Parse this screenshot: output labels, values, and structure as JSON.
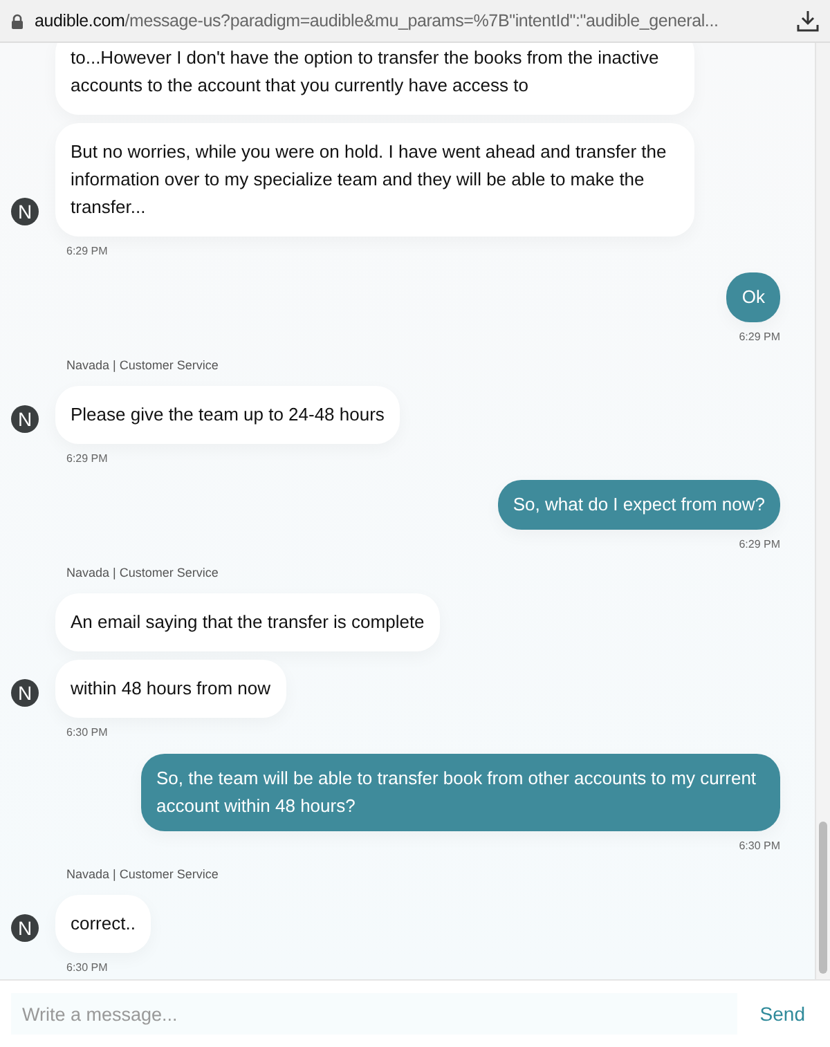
{
  "address_bar": {
    "url_host": "audible.com",
    "url_path": "/message-us?paradigm=audible&mu_params=%7B\"intentId\":\"audible_general..."
  },
  "conversation": [
    {
      "kind": "agent",
      "avatar": "N",
      "messages": [
        "to...However I don't have the option to transfer the books from the inactive accounts to the account that you currently have access to",
        "But no worries, while you were on hold. I have went ahead and transfer the information over to my specialize team and they will be able to make the transfer..."
      ],
      "time": "6:29 PM"
    },
    {
      "kind": "user",
      "messages": [
        "Ok"
      ],
      "time": "6:29 PM"
    },
    {
      "kind": "agent",
      "label": "Navada | Customer Service",
      "avatar": "N",
      "messages": [
        "Please give the team up to 24-48 hours"
      ],
      "time": "6:29 PM"
    },
    {
      "kind": "user",
      "messages": [
        "So, what do I expect from now?"
      ],
      "time": "6:29 PM"
    },
    {
      "kind": "agent",
      "label": "Navada | Customer Service",
      "avatar": "N",
      "messages": [
        "An email saying that the transfer is complete",
        "within 48 hours from now"
      ],
      "time": "6:30 PM"
    },
    {
      "kind": "user",
      "messages": [
        "So, the team will be able to transfer book from other accounts to my current account within 48 hours?"
      ],
      "time": "6:30 PM"
    },
    {
      "kind": "agent",
      "label": "Navada | Customer Service",
      "avatar": "N",
      "messages": [
        "correct.."
      ],
      "time": "6:30 PM"
    }
  ],
  "composer": {
    "placeholder": "Write a message...",
    "send": "Send"
  }
}
